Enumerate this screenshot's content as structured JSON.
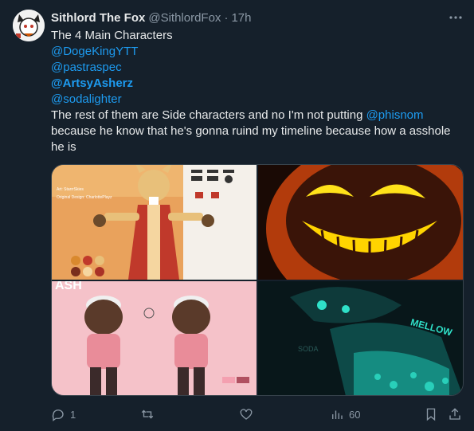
{
  "tweet": {
    "author_name": "Sithlord The Fox",
    "author_handle": "@SithlordFox",
    "separator": "·",
    "time": "17h",
    "line1": "The 4 Main Characters",
    "mention1": "@DogeKingYTT",
    "mention2": "@pastraspec",
    "mention3": "@ArtsyAsherz",
    "mention4": "@sodalighter",
    "para_pre": "The rest of them are Side characters and no I'm not putting ",
    "para_mention": "@phisnom",
    "para_post": " because he know that he's gonna ruind my timeline because how a asshole he is"
  },
  "media": {
    "img1_text_a": "Art: StarrrSkies",
    "img1_text_b": "Original Design: CharlottePlayz",
    "img3_text_a": "ASH",
    "img4_text_a": "MELLOW",
    "img4_text_b": "SODA"
  },
  "actions": {
    "reply_count": "1",
    "retweet_count": "",
    "like_count": "",
    "views_count": "60"
  },
  "colors": {
    "background": "#15202b",
    "link": "#1d9bf0",
    "muted": "#8b98a5"
  },
  "icons": [
    "more-icon",
    "reply-icon",
    "retweet-icon",
    "like-icon",
    "views-icon",
    "bookmark-icon",
    "share-icon"
  ]
}
